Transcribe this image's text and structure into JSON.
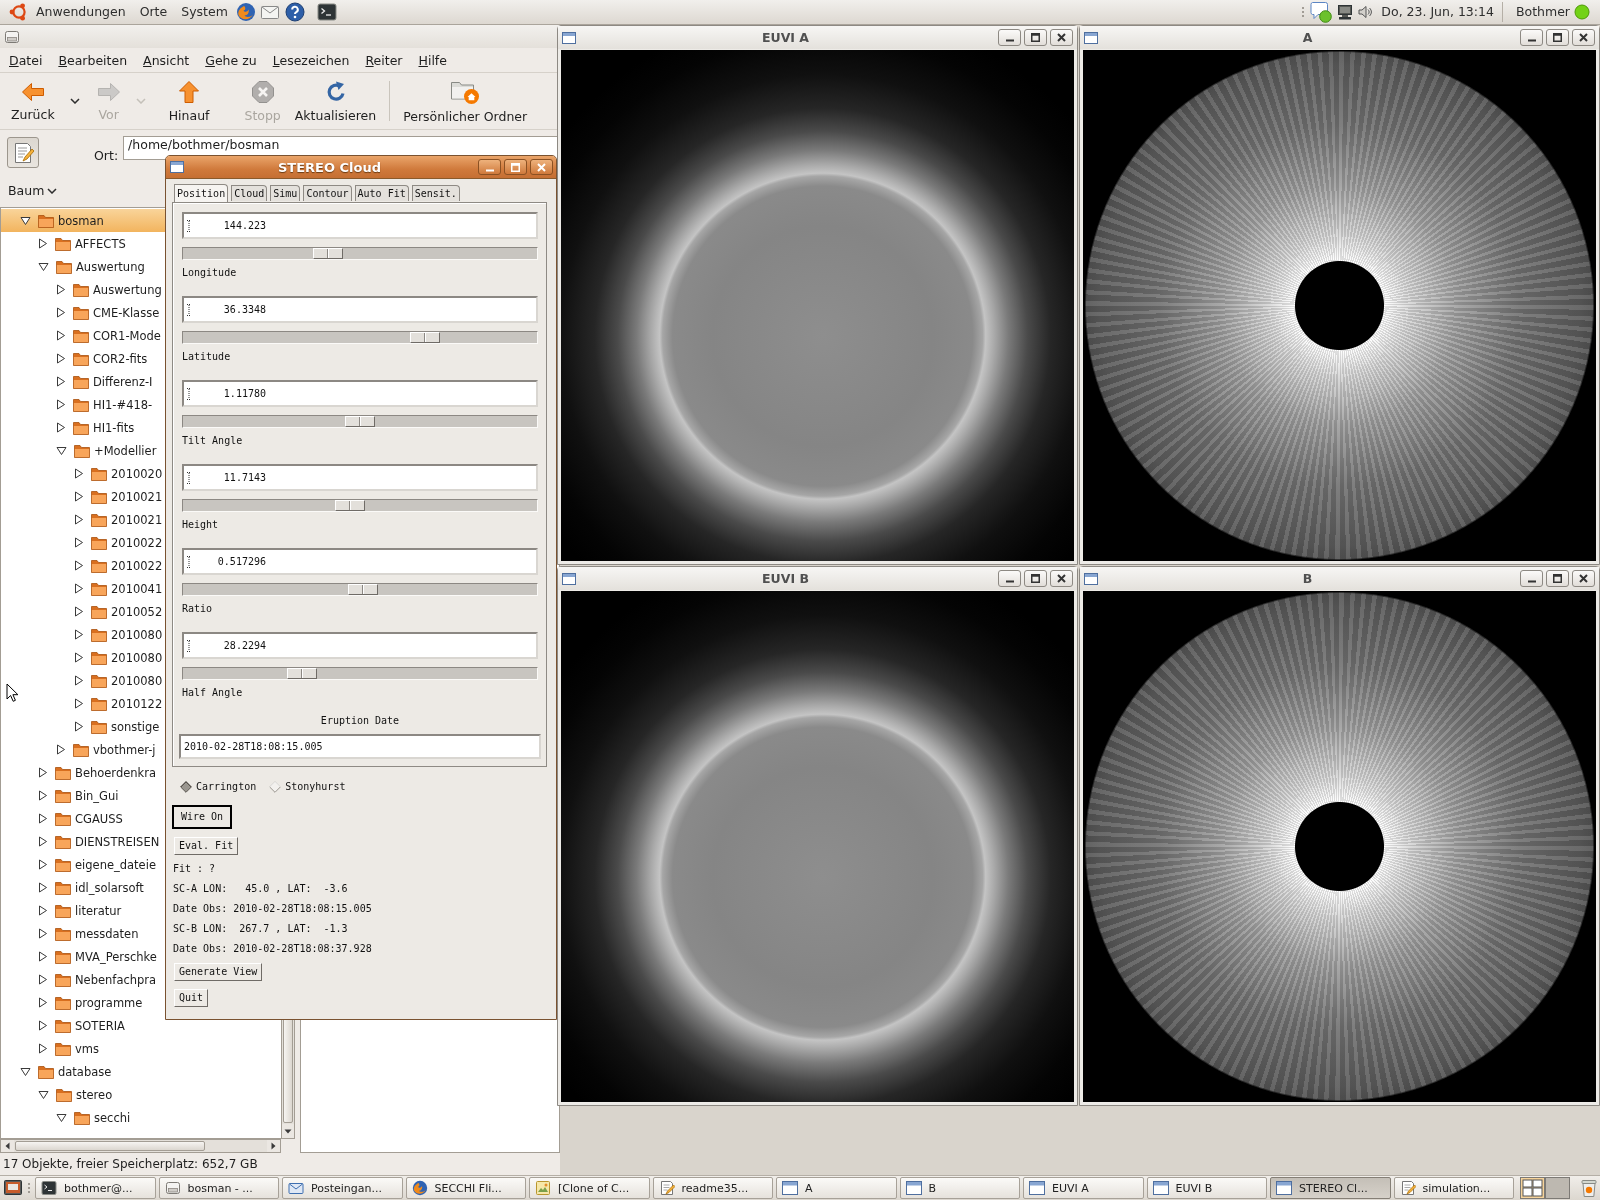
{
  "top_panel": {
    "menus": [
      "Anwendungen",
      "Orte",
      "System"
    ],
    "clock": "Do, 23. Jun, 13:14",
    "user": "Bothmer"
  },
  "file_manager": {
    "menu": [
      "Datei",
      "Bearbeiten",
      "Ansicht",
      "Gehe zu",
      "Lesezeichen",
      "Reiter",
      "Hilfe"
    ],
    "toolbar": [
      {
        "kind": "back",
        "label": "Zurück",
        "disabled": false
      },
      {
        "kind": "dropdown",
        "disabled": false
      },
      {
        "kind": "forward",
        "label": "Vor",
        "disabled": true
      },
      {
        "kind": "dropdown",
        "disabled": true
      },
      {
        "kind": "up",
        "label": "Hinauf",
        "disabled": false
      },
      {
        "kind": "stop",
        "label": "Stopp",
        "disabled": true
      },
      {
        "kind": "reload",
        "label": "Aktualisieren",
        "disabled": false
      },
      {
        "kind": "separator"
      },
      {
        "kind": "home",
        "label": "Persönlicher Ordner",
        "disabled": false
      }
    ],
    "location": {
      "label": "Ort:",
      "value": "/home/bothmer/bosman"
    },
    "sidebar": {
      "selector": "Baum",
      "tree": [
        {
          "label": "bosman",
          "expanded": true,
          "selected": true,
          "children": [
            {
              "label": "AFFECTS",
              "expanded": false,
              "selected": false
            },
            {
              "label": "Auswertung",
              "expanded": true,
              "selected": false,
              "children": [
                {
                  "label": "Auswertung",
                  "expanded": false,
                  "selected": false
                },
                {
                  "label": "CME-Klasse",
                  "expanded": false,
                  "selected": false
                },
                {
                  "label": "COR1-Mode",
                  "expanded": false,
                  "selected": false
                },
                {
                  "label": "COR2-fits",
                  "expanded": false,
                  "selected": false
                },
                {
                  "label": "Differenz-I",
                  "expanded": false,
                  "selected": false
                },
                {
                  "label": "HI1-#418-",
                  "expanded": false,
                  "selected": false
                },
                {
                  "label": "HI1-fits",
                  "expanded": false,
                  "selected": false
                },
                {
                  "label": "+Modellier",
                  "expanded": true,
                  "selected": false,
                  "children": [
                    {
                      "label": "2010020",
                      "expanded": false,
                      "selected": false
                    },
                    {
                      "label": "2010021",
                      "expanded": false,
                      "selected": false
                    },
                    {
                      "label": "2010021",
                      "expanded": false,
                      "selected": false
                    },
                    {
                      "label": "2010022",
                      "expanded": false,
                      "selected": false
                    },
                    {
                      "label": "2010022",
                      "expanded": false,
                      "selected": false
                    },
                    {
                      "label": "2010041",
                      "expanded": false,
                      "selected": false
                    },
                    {
                      "label": "2010052",
                      "expanded": false,
                      "selected": false
                    },
                    {
                      "label": "2010080",
                      "expanded": false,
                      "selected": false
                    },
                    {
                      "label": "2010080",
                      "expanded": false,
                      "selected": false
                    },
                    {
                      "label": "2010080",
                      "expanded": false,
                      "selected": false
                    },
                    {
                      "label": "2010122",
                      "expanded": false,
                      "selected": false
                    },
                    {
                      "label": "sonstige",
                      "expanded": false,
                      "selected": false
                    }
                  ]
                },
                {
                  "label": "vbothmer-j",
                  "expanded": false,
                  "selected": false
                }
              ]
            },
            {
              "label": "Behoerdenkra",
              "expanded": false,
              "selected": false
            },
            {
              "label": "Bin_Gui",
              "expanded": false,
              "selected": false
            },
            {
              "label": "CGAUSS",
              "expanded": false,
              "selected": false
            },
            {
              "label": "DIENSTREISEN",
              "expanded": false,
              "selected": false
            },
            {
              "label": "eigene_dateie",
              "expanded": false,
              "selected": false
            },
            {
              "label": "idl_solarsoft",
              "expanded": false,
              "selected": false
            },
            {
              "label": "literatur",
              "expanded": false,
              "selected": false
            },
            {
              "label": "messdaten",
              "expanded": false,
              "selected": false
            },
            {
              "label": "MVA_Perschke",
              "expanded": false,
              "selected": false
            },
            {
              "label": "Nebenfachpra",
              "expanded": false,
              "selected": false
            },
            {
              "label": "programme",
              "expanded": false,
              "selected": false
            },
            {
              "label": "SOTERIA",
              "expanded": false,
              "selected": false
            },
            {
              "label": "vms",
              "expanded": false,
              "selected": false
            }
          ]
        },
        {
          "label": "database",
          "expanded": true,
          "selected": false,
          "children": [
            {
              "label": "stereo",
              "expanded": true,
              "selected": false,
              "children": [
                {
                  "label": "secchi",
                  "expanded": true,
                  "selected": false
                }
              ]
            }
          ]
        }
      ]
    },
    "status_bar": "17 Objekte, freier Speicherplatz: 652,7 GB"
  },
  "cloud_dialog": {
    "title": "STEREO Cloud",
    "tabs": [
      {
        "label": "Position",
        "selected": true
      },
      {
        "label": "Cloud",
        "selected": false
      },
      {
        "label": "Simu",
        "selected": false
      },
      {
        "label": "Contour",
        "selected": false
      },
      {
        "label": "Auto Fit",
        "selected": false
      },
      {
        "label": "Sensit.",
        "selected": false
      }
    ],
    "parameters": [
      {
        "value": "144.223",
        "slider": {
          "level": 0.4,
          "title": "Longitude"
        }
      },
      {
        "value": "36.3348",
        "slider": {
          "level": 0.7,
          "title": "Latitude"
        }
      },
      {
        "value": "1.11780",
        "slider": {
          "level": 0.5,
          "title": "Tilt Angle"
        }
      },
      {
        "value": "11.7143",
        "slider": {
          "level": 0.47,
          "title": "Height"
        }
      },
      {
        "value": "0.517296",
        "slider": {
          "level": 0.51,
          "title": "Ratio"
        }
      },
      {
        "value": "28.2294",
        "slider": {
          "level": 0.32,
          "title": "Half Angle"
        }
      }
    ],
    "eruption_date": {
      "label": "Eruption Date",
      "value": "2010-02-28T18:08:15.005"
    },
    "coordinate_systems": [
      {
        "label": "Carrington",
        "selected": true
      },
      {
        "label": "Stonyhurst",
        "selected": false
      }
    ],
    "controls": [
      {
        "kind": "button",
        "label": "Wire On",
        "default": true
      },
      {
        "kind": "button",
        "label": "Eval. Fit",
        "default": false
      },
      {
        "kind": "text",
        "text": "Fit : ?"
      },
      {
        "kind": "text",
        "text": "SC-A LON:   45.0 , LAT:  -3.6"
      },
      {
        "kind": "text",
        "text": "Date Obs: 2010-02-28T18:08:15.005"
      },
      {
        "kind": "text",
        "text": "SC-B LON:  267.7 , LAT:  -1.3"
      },
      {
        "kind": "text",
        "text": "Date Obs: 2010-02-28T18:08:37.928"
      },
      {
        "kind": "button",
        "label": "Generate View",
        "default": false
      },
      {
        "kind": "button",
        "label": "Quit",
        "default": false
      }
    ]
  },
  "image_windows": [
    {
      "title": "EUVI A",
      "kind": "euv"
    },
    {
      "title": "A",
      "kind": "coronagraph"
    },
    {
      "title": "EUVI B",
      "kind": "euv"
    },
    {
      "title": "B",
      "kind": "coronagraph"
    }
  ],
  "taskbar": [
    {
      "kind": "terminal",
      "label": "bothmer@...",
      "selected": false
    },
    {
      "kind": "files",
      "label": "bosman - ...",
      "selected": false
    },
    {
      "kind": "mail",
      "label": "Posteingan...",
      "selected": false
    },
    {
      "kind": "browser",
      "label": "SECCHI Fli...",
      "selected": false
    },
    {
      "kind": "image",
      "label": "[Clone of C...",
      "selected": false
    },
    {
      "kind": "text",
      "label": "readme35...",
      "selected": false
    },
    {
      "kind": "window",
      "label": "A",
      "selected": false
    },
    {
      "kind": "window",
      "label": "B",
      "selected": false
    },
    {
      "kind": "window",
      "label": "EUVI A",
      "selected": false
    },
    {
      "kind": "window",
      "label": "EUVI B",
      "selected": false
    },
    {
      "kind": "window",
      "label": "STEREO Cl...",
      "selected": true
    },
    {
      "kind": "editor",
      "label": "simulation...",
      "selected": false
    }
  ]
}
